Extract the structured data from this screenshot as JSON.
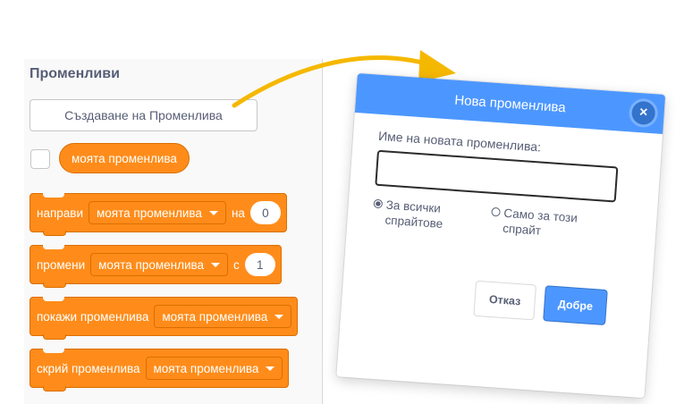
{
  "palette": {
    "title": "Променливи",
    "make_variable_label": "Създаване на Променлива",
    "reporter_label": "моята променлива",
    "blocks": [
      {
        "label": "направи",
        "dropdown": "моята променлива",
        "connector": "на",
        "value": "0"
      },
      {
        "label": "промени",
        "dropdown": "моята променлива",
        "connector": "с",
        "value": "1"
      },
      {
        "label": "покажи променлива",
        "dropdown": "моята променлива"
      },
      {
        "label": "скрий променлива",
        "dropdown": "моята променлива"
      }
    ]
  },
  "dialog": {
    "title": "Нова променлива",
    "close_symbol": "×",
    "name_label": "Име на новата променлива:",
    "name_value": "",
    "radio_all": "За всички спрайтове",
    "radio_this": "Само за този спрайт",
    "cancel_label": "Отказ",
    "ok_label": "Добре"
  },
  "colors": {
    "block_orange": "#ff8c1a",
    "dialog_blue": "#4c97ff",
    "callout_yellow": "#f5b800"
  }
}
